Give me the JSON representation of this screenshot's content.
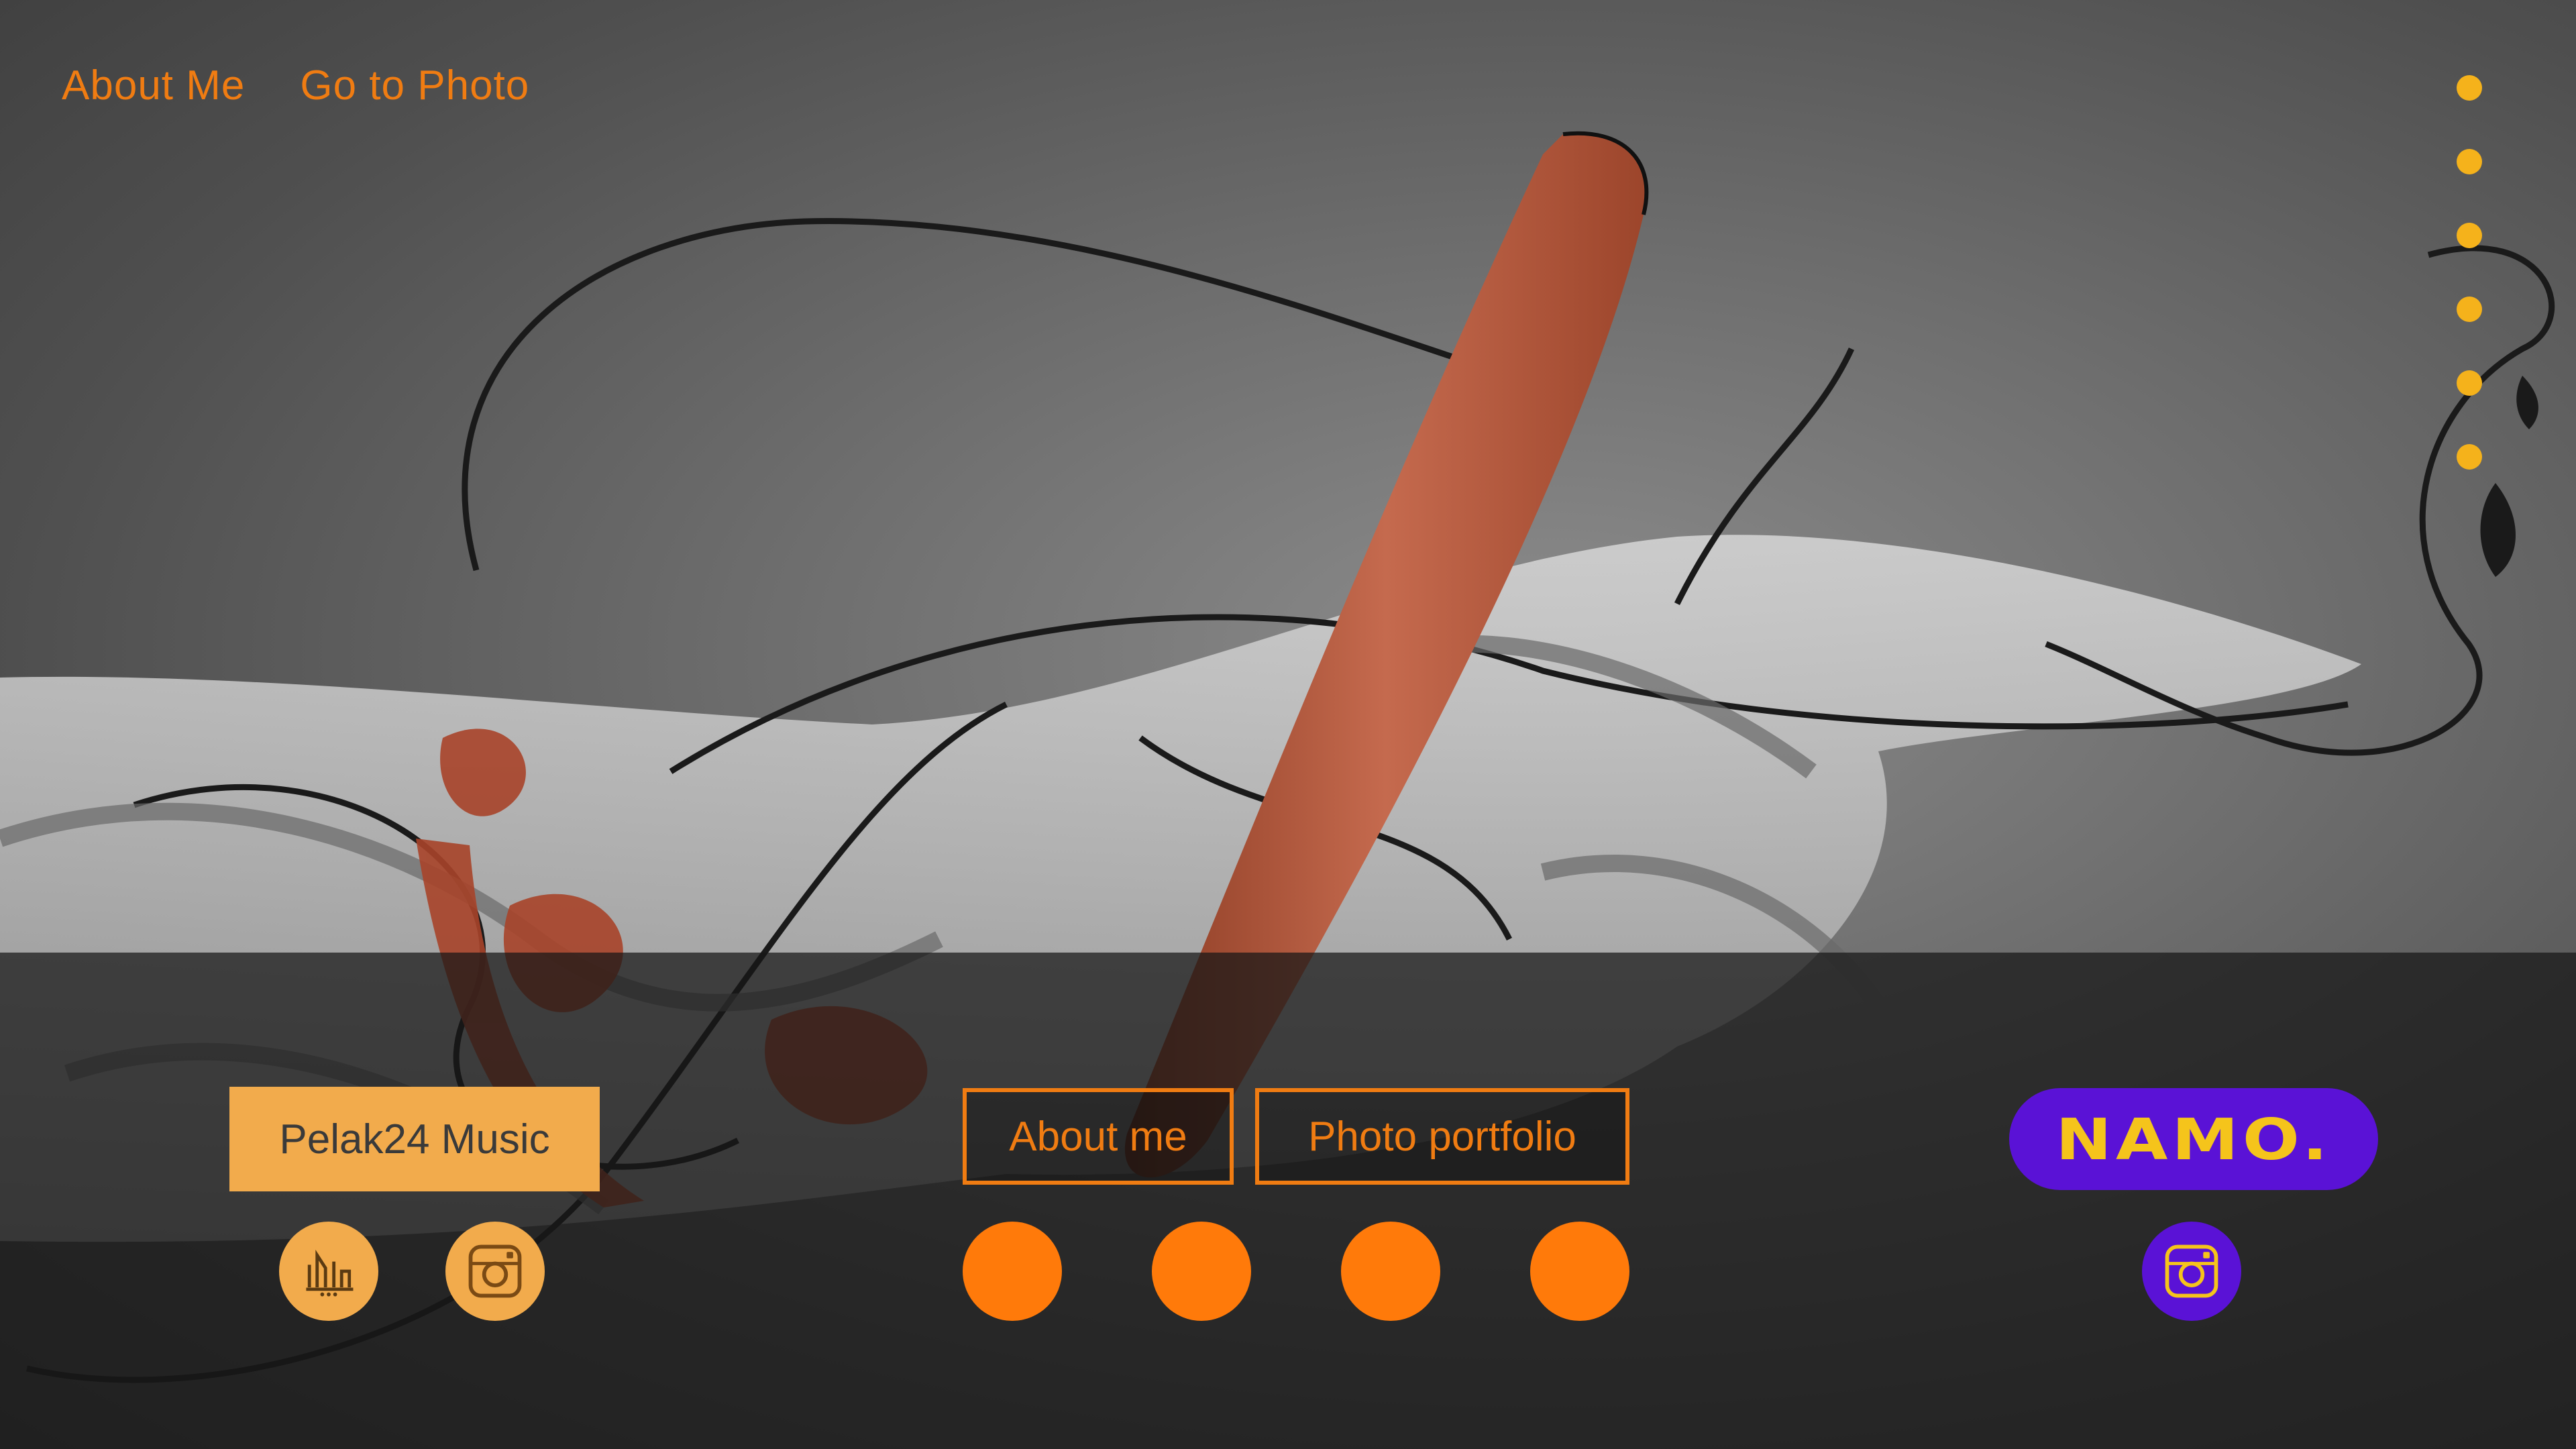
{
  "top_nav": {
    "about_label": "About Me",
    "photo_label": "Go to Photo"
  },
  "side_nav": {
    "dot_count": 6
  },
  "left_block": {
    "music_button_label": "Pelak24 Music",
    "icons": [
      "pelak24-logo-icon",
      "instagram-icon"
    ]
  },
  "center_block": {
    "about_button_label": "About me",
    "portfolio_button_label": "Photo portfolio",
    "circle_count": 4
  },
  "right_block": {
    "brand_label": "NAMO.",
    "icons": [
      "instagram-icon"
    ]
  },
  "colors": {
    "accent_orange": "#f07c12",
    "accent_tan": "#f2ab4c",
    "accent_yellow": "#f5b21b",
    "brand_purple": "#5a12d6",
    "brand_yellow": "#f5c41b"
  }
}
